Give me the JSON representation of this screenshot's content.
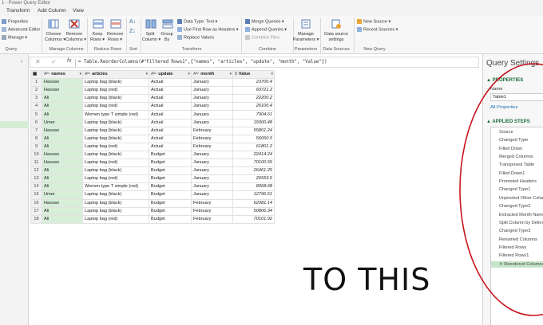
{
  "window": {
    "title": "1 - Power Query Editor"
  },
  "tabs": [
    "Transform",
    "Add Column",
    "View"
  ],
  "ribbon": {
    "left_items": [
      "Properties",
      "Advanced Editor",
      "Manage ▾"
    ],
    "query_group": "Query",
    "choose_columns": [
      "Choose",
      "Columns ▾"
    ],
    "remove_columns": [
      "Remove",
      "Columns ▾"
    ],
    "manage_columns_group": "Manage Columns",
    "keep_rows": [
      "Keep",
      "Rows ▾"
    ],
    "remove_rows": [
      "Remove",
      "Rows ▾"
    ],
    "reduce_rows_group": "Reduce Rows",
    "sort_group": "Sort",
    "split_column": [
      "Split",
      "Column ▾"
    ],
    "group_by": [
      "Group",
      "By"
    ],
    "data_type": "Data Type: Text ▾",
    "first_row_headers": "Use First Row as Headers ▾",
    "replace_values": "Replace Values",
    "transform_group": "Transform",
    "merge_queries": "Merge Queries ▾",
    "append_queries": "Append Queries ▾",
    "combine_files": "Combine Files",
    "combine_group": "Combine",
    "manage_parameters": [
      "Manage",
      "Parameters ▾"
    ],
    "parameters_group": "Parameters",
    "data_source_settings": [
      "Data source",
      "settings"
    ],
    "data_sources_group": "Data Sources",
    "new_source": "New Source ▾",
    "recent_sources": "Recent Sources ▾",
    "new_query_group": "New Query"
  },
  "formula_bar": {
    "cancel_glyph": "✕",
    "confirm_glyph": "✓",
    "fx": "fx",
    "formula": "= Table.ReorderColumns(#\"Filtered Rows1\",{\"names\", \"articles\", \"update\", \"month\", \"Value\"})"
  },
  "grid": {
    "columns": [
      {
        "type": "Aᴮᶜ",
        "name": "names"
      },
      {
        "type": "Aᴮᶜ",
        "name": "articles"
      },
      {
        "type": "Aᴮᶜ",
        "name": "update"
      },
      {
        "type": "Aᴮᶜ",
        "name": "month"
      },
      {
        "type": "$",
        "name": "Value"
      }
    ],
    "rows": [
      [
        "1",
        "Hassan",
        "Laptop bag (black)",
        "Actual",
        "January",
        "23700.4"
      ],
      [
        "2",
        "Hassan",
        "Laptop bag (red)",
        "Actual",
        "January",
        "60721.2"
      ],
      [
        "3",
        "Ali",
        "Laptop bag (black)",
        "Actual",
        "January",
        "22200.2"
      ],
      [
        "4",
        "Ali",
        "Laptop bag (red)",
        "Actual",
        "January",
        "26100.4"
      ],
      [
        "5",
        "Ali",
        "Women type T simple (red)",
        "Actual",
        "January",
        "7904.61"
      ],
      [
        "6",
        "Umer",
        "Laptop bag (black)",
        "Actual",
        "January",
        "15000.48"
      ],
      [
        "7",
        "Hassan",
        "Laptop bag (black)",
        "Actual",
        "February",
        "55801.24"
      ],
      [
        "8",
        "Ali",
        "Laptop bag (black)",
        "Actual",
        "February",
        "56060.5"
      ],
      [
        "9",
        "Ali",
        "Laptop bag (red)",
        "Actual",
        "February",
        "61801.2"
      ],
      [
        "10",
        "Hassan",
        "Laptop bag (black)",
        "Budget",
        "January",
        "22414.24"
      ],
      [
        "11",
        "Hassan",
        "Laptop bag (red)",
        "Budget",
        "January",
        "70100.55"
      ],
      [
        "12",
        "Ali",
        "Laptop bag (black)",
        "Budget",
        "January",
        "26461.25"
      ],
      [
        "13",
        "Ali",
        "Laptop bag (red)",
        "Budget",
        "January",
        "26553.5"
      ],
      [
        "14",
        "Ali",
        "Women type T simple (red)",
        "Budget",
        "January",
        "8968.68"
      ],
      [
        "15",
        "Umer",
        "Laptop bag (black)",
        "Budget",
        "January",
        "12796.51"
      ],
      [
        "16",
        "Hassan",
        "Laptop bag (black)",
        "Budget",
        "February",
        "62981.14"
      ],
      [
        "17",
        "Ali",
        "Laptop bag (black)",
        "Budget",
        "February",
        "50806.34"
      ],
      [
        "18",
        "Ali",
        "Laptop bag (red)",
        "Budget",
        "February",
        "70101.92"
      ]
    ]
  },
  "query_settings": {
    "title": "Query Settings",
    "properties_header": "▲ PROPERTIES",
    "name_label": "Name",
    "name_value": "Table1",
    "all_properties": "All Properties",
    "applied_steps_header": "▲ APPLIED STEPS",
    "steps": [
      "Source",
      "Changed Type",
      "Filled Down",
      "Merged Columns",
      "Transposed Table",
      "Filled Down1",
      "Promoted Headers",
      "Changed Type1",
      "Unpivoted Other Columns",
      "Changed Type2",
      "Extracted Month Name",
      "Split Column by Delimiter",
      "Changed Type3",
      "Renamed Columns",
      "Filtered Rows",
      "Filtered Rows1",
      "✕ Reordered Columns"
    ],
    "selected_step_index": 16
  },
  "annotation": {
    "text": "TO THIS",
    "circle_color": "#c8141e"
  }
}
